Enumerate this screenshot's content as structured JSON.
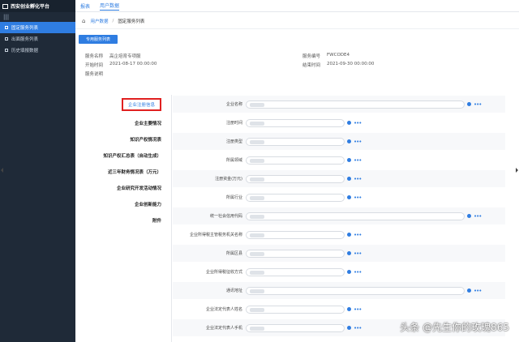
{
  "app": {
    "title": "西安创业孵化平台"
  },
  "sidebar": {
    "collapse_icon": "menu-icon",
    "items": [
      {
        "label": "固定服务列表",
        "active": true
      },
      {
        "label": "出面服务列表",
        "active": false
      },
      {
        "label": "历史填报数据",
        "active": false
      }
    ]
  },
  "topbar": {
    "items": [
      "报表",
      "用户数据"
    ]
  },
  "breadcrumb": {
    "items": [
      "用户数据",
      "固定服务列表"
    ]
  },
  "main": {
    "primary_button": "专用服务列表",
    "info": {
      "service_name_label": "服务名称",
      "service_name_value": "高企培育专项服",
      "service_no_label": "服务编号",
      "service_no_value": "FWCODE4",
      "start_label": "开始时间",
      "start_value": "2021-08-17 00:00:00",
      "end_label": "结束时间",
      "end_value": "2021-09-30 00:00:00",
      "desc_label": "服务说明"
    },
    "sections": [
      "企业注册信息",
      "企业主要情况",
      "知识产权情况表",
      "知识产权汇总表（自动生成）",
      "近三年财务情况表（万元）",
      "企业研究开发活动情况",
      "企业创新能力",
      "附件"
    ],
    "fields": [
      "企业名称",
      "注册时间",
      "注册类型",
      "所属领域",
      "注册资金(万元)",
      "所属行业",
      "统一社会信用代码",
      "企业所得税主管税务机关名称",
      "所属区县",
      "企业所得税征收方式",
      "通讯地址",
      "企业法定代表人姓名",
      "企业法定代表人手机"
    ]
  },
  "watermark": "头条 @先生你的玫瑰865",
  "colors": {
    "accent": "#2f7de1",
    "sidebar": "#1f2a38",
    "highlight": "#e02020"
  }
}
